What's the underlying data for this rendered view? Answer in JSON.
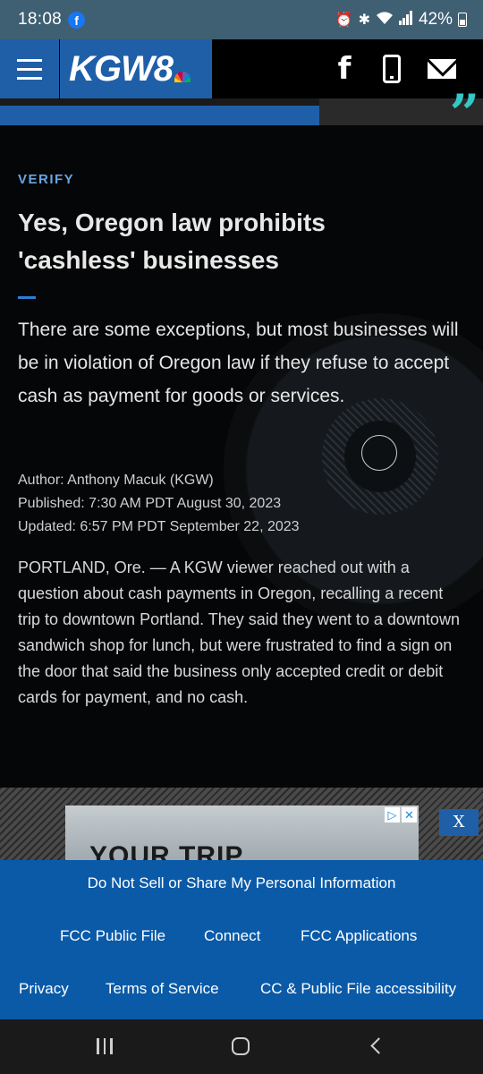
{
  "status_bar": {
    "time": "18:08",
    "app_badge": "f",
    "battery": "42%"
  },
  "header": {
    "logo": "KGW8"
  },
  "article": {
    "kicker": "VERIFY",
    "headline": "Yes, Oregon law prohibits 'cashless' businesses",
    "summary": "There are some exceptions, but most businesses will be in violation of Oregon law if they refuse to accept cash as payment for goods or services.",
    "author": "Author: Anthony Macuk (KGW)",
    "published": "Published: 7:30 AM PDT August 30, 2023",
    "updated": "Updated: 6:57 PM PDT September 22, 2023",
    "body": "PORTLAND, Ore. — A KGW viewer reached out with a question about cash payments in Oregon, recalling a recent trip to downtown Portland. They said they went to a downtown sandwich shop for lunch, but were frustrated to find a sign on the door that said the business only accepted credit or debit cards for payment, and no cash."
  },
  "ad": {
    "title": "YOUR TRIP",
    "close_label": "X"
  },
  "footer": {
    "do_not_sell": "Do Not Sell or Share My Personal Information",
    "fcc_public_file": "FCC Public File",
    "connect": "Connect",
    "fcc_applications": "FCC Applications",
    "privacy": "Privacy",
    "terms": "Terms of Service",
    "cc_accessibility": "CC & Public File accessibility"
  }
}
